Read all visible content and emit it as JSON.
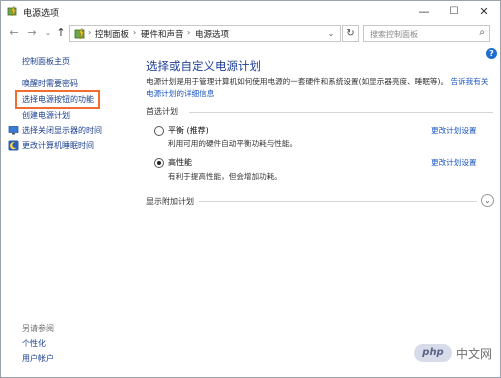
{
  "window": {
    "title": "电源选项",
    "minimize": "—",
    "maximize": "☐",
    "close": "✕"
  },
  "address": {
    "back": "←",
    "forward": "→",
    "recent": "⌄",
    "up": "↑",
    "breadcrumb": [
      "控制面板",
      "硬件和声音",
      "电源选项"
    ],
    "separator": "›",
    "dropdown": "⌄",
    "refresh": "↻",
    "search_placeholder": "搜索控制面板",
    "search_icon": "⌕"
  },
  "sidebar": {
    "home": "控制面板主页",
    "items": [
      {
        "label": "唤醒时需要密码",
        "icon": ""
      },
      {
        "label": "选择电源按钮的功能",
        "icon": ""
      },
      {
        "label": "创建电源计划",
        "icon": ""
      },
      {
        "label": "选择关闭显示器的时间",
        "icon": "monitor-icon"
      },
      {
        "label": "更改计算机睡眠时间",
        "icon": "moon-icon"
      }
    ],
    "see_also": {
      "heading": "另请参阅",
      "links": [
        "个性化",
        "用户帐户"
      ]
    }
  },
  "main": {
    "title": "选择或自定义电源计划",
    "description": "电源计划是用于管理计算机如何使用电源的一套硬件和系统设置(如显示器亮度、睡眠等)。",
    "description_link": "告诉我有关电源计划的详细信息",
    "preferred_label": "首选计划",
    "plans": [
      {
        "name": "平衡 (推荐)",
        "desc": "利用可用的硬件自动平衡功耗与性能。",
        "link": "更改计划设置",
        "selected": false
      },
      {
        "name": "高性能",
        "desc": "有利于提高性能，但会增加功耗。",
        "link": "更改计划设置",
        "selected": true
      }
    ],
    "additional_label": "显示附加计划",
    "expand_icon": "⌄"
  },
  "help": {
    "glyph": "?"
  },
  "watermark": {
    "logo": "php",
    "text": "中文网"
  },
  "colors": {
    "link": "#1a3f8f",
    "title": "#1f3f97",
    "highlight": "#ef6c32"
  }
}
